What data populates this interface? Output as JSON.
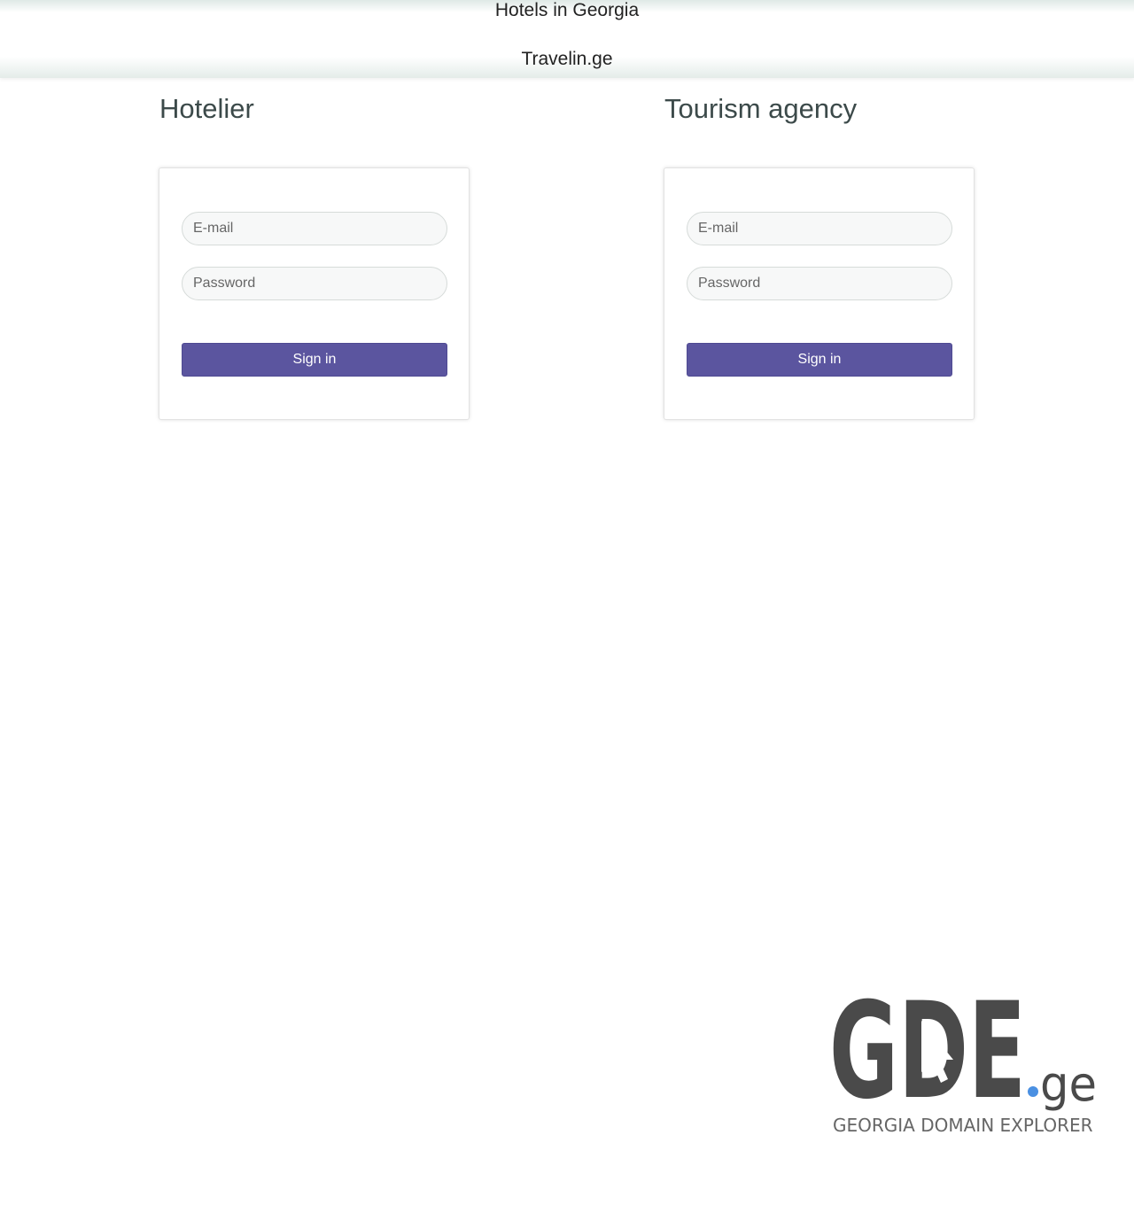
{
  "header": {
    "line1": "Hotels in Georgia",
    "line2": "Travelin.ge"
  },
  "hotelier": {
    "title": "Hotelier",
    "email_placeholder": "E-mail",
    "password_placeholder": "Password",
    "signin_label": "Sign in"
  },
  "agency": {
    "title": "Tourism agency",
    "email_placeholder": "E-mail",
    "password_placeholder": "Password",
    "signin_label": "Sign in"
  },
  "footer_logo": {
    "wordmark": "GDE",
    "tld": ".ge",
    "tagline": "GEORGIA DOMAIN EXPLORER",
    "colors": {
      "mark": "#4a4a4a",
      "dot": "#4a90e2"
    }
  },
  "colors": {
    "button": "#5b559f",
    "title": "#3c4a4a"
  }
}
